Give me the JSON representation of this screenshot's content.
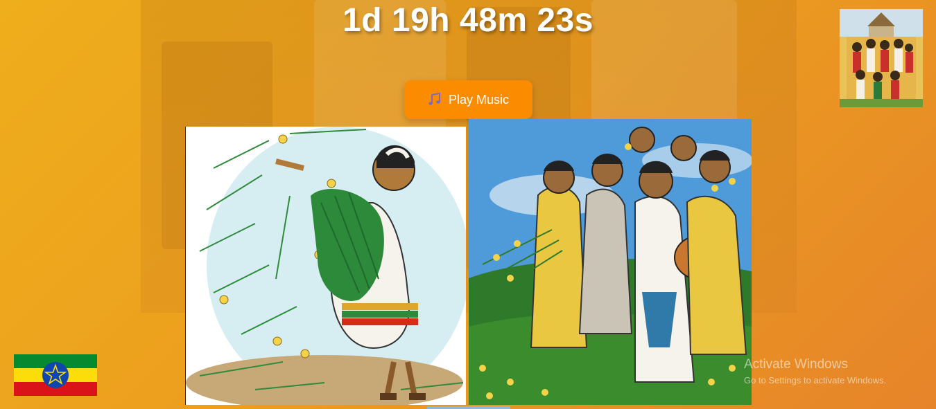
{
  "countdown": {
    "text": "1d 19h 48m 23s"
  },
  "player": {
    "play_label": "Play Music",
    "icon": "music-note-icon"
  },
  "images": {
    "thumbnail": "celebration-group-thumbnail",
    "left_art": "woman-carrying-flowers-and-grass-illustration",
    "right_art": "women-group-with-yellow-flowers-illustration",
    "flag": "ethiopia-flag"
  },
  "flag_colors": {
    "green": "#078930",
    "yellow": "#fcdd09",
    "red": "#da121a",
    "emblem": "#0f47af"
  },
  "watermark": {
    "title": "Activate Windows",
    "subtitle": "Go to Settings to activate Windows."
  }
}
